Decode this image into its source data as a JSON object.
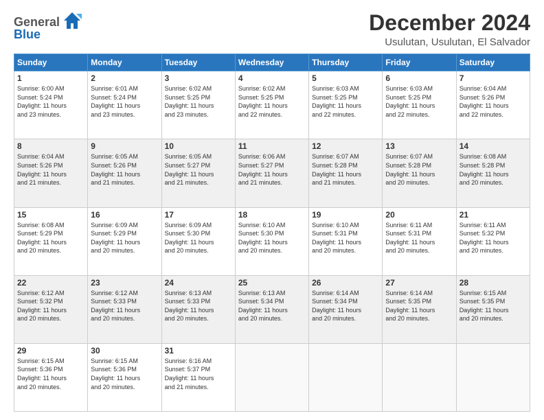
{
  "logo": {
    "general": "General",
    "blue": "Blue"
  },
  "title": "December 2024",
  "subtitle": "Usulutan, Usulutan, El Salvador",
  "calendar": {
    "headers": [
      "Sunday",
      "Monday",
      "Tuesday",
      "Wednesday",
      "Thursday",
      "Friday",
      "Saturday"
    ],
    "weeks": [
      [
        {
          "day": "",
          "info": ""
        },
        {
          "day": "2",
          "info": "Sunrise: 6:01 AM\nSunset: 5:24 PM\nDaylight: 11 hours\nand 23 minutes."
        },
        {
          "day": "3",
          "info": "Sunrise: 6:02 AM\nSunset: 5:25 PM\nDaylight: 11 hours\nand 23 minutes."
        },
        {
          "day": "4",
          "info": "Sunrise: 6:02 AM\nSunset: 5:25 PM\nDaylight: 11 hours\nand 22 minutes."
        },
        {
          "day": "5",
          "info": "Sunrise: 6:03 AM\nSunset: 5:25 PM\nDaylight: 11 hours\nand 22 minutes."
        },
        {
          "day": "6",
          "info": "Sunrise: 6:03 AM\nSunset: 5:25 PM\nDaylight: 11 hours\nand 22 minutes."
        },
        {
          "day": "7",
          "info": "Sunrise: 6:04 AM\nSunset: 5:26 PM\nDaylight: 11 hours\nand 22 minutes."
        }
      ],
      [
        {
          "day": "1",
          "info": "Sunrise: 6:00 AM\nSunset: 5:24 PM\nDaylight: 11 hours\nand 23 minutes."
        },
        {
          "day": "9",
          "info": "Sunrise: 6:05 AM\nSunset: 5:26 PM\nDaylight: 11 hours\nand 21 minutes."
        },
        {
          "day": "10",
          "info": "Sunrise: 6:05 AM\nSunset: 5:27 PM\nDaylight: 11 hours\nand 21 minutes."
        },
        {
          "day": "11",
          "info": "Sunrise: 6:06 AM\nSunset: 5:27 PM\nDaylight: 11 hours\nand 21 minutes."
        },
        {
          "day": "12",
          "info": "Sunrise: 6:07 AM\nSunset: 5:28 PM\nDaylight: 11 hours\nand 21 minutes."
        },
        {
          "day": "13",
          "info": "Sunrise: 6:07 AM\nSunset: 5:28 PM\nDaylight: 11 hours\nand 20 minutes."
        },
        {
          "day": "14",
          "info": "Sunrise: 6:08 AM\nSunset: 5:28 PM\nDaylight: 11 hours\nand 20 minutes."
        }
      ],
      [
        {
          "day": "8",
          "info": "Sunrise: 6:04 AM\nSunset: 5:26 PM\nDaylight: 11 hours\nand 21 minutes."
        },
        {
          "day": "16",
          "info": "Sunrise: 6:09 AM\nSunset: 5:29 PM\nDaylight: 11 hours\nand 20 minutes."
        },
        {
          "day": "17",
          "info": "Sunrise: 6:09 AM\nSunset: 5:30 PM\nDaylight: 11 hours\nand 20 minutes."
        },
        {
          "day": "18",
          "info": "Sunrise: 6:10 AM\nSunset: 5:30 PM\nDaylight: 11 hours\nand 20 minutes."
        },
        {
          "day": "19",
          "info": "Sunrise: 6:10 AM\nSunset: 5:31 PM\nDaylight: 11 hours\nand 20 minutes."
        },
        {
          "day": "20",
          "info": "Sunrise: 6:11 AM\nSunset: 5:31 PM\nDaylight: 11 hours\nand 20 minutes."
        },
        {
          "day": "21",
          "info": "Sunrise: 6:11 AM\nSunset: 5:32 PM\nDaylight: 11 hours\nand 20 minutes."
        }
      ],
      [
        {
          "day": "15",
          "info": "Sunrise: 6:08 AM\nSunset: 5:29 PM\nDaylight: 11 hours\nand 20 minutes."
        },
        {
          "day": "23",
          "info": "Sunrise: 6:12 AM\nSunset: 5:33 PM\nDaylight: 11 hours\nand 20 minutes."
        },
        {
          "day": "24",
          "info": "Sunrise: 6:13 AM\nSunset: 5:33 PM\nDaylight: 11 hours\nand 20 minutes."
        },
        {
          "day": "25",
          "info": "Sunrise: 6:13 AM\nSunset: 5:34 PM\nDaylight: 11 hours\nand 20 minutes."
        },
        {
          "day": "26",
          "info": "Sunrise: 6:14 AM\nSunset: 5:34 PM\nDaylight: 11 hours\nand 20 minutes."
        },
        {
          "day": "27",
          "info": "Sunrise: 6:14 AM\nSunset: 5:35 PM\nDaylight: 11 hours\nand 20 minutes."
        },
        {
          "day": "28",
          "info": "Sunrise: 6:15 AM\nSunset: 5:35 PM\nDaylight: 11 hours\nand 20 minutes."
        }
      ],
      [
        {
          "day": "22",
          "info": "Sunrise: 6:12 AM\nSunset: 5:32 PM\nDaylight: 11 hours\nand 20 minutes."
        },
        {
          "day": "30",
          "info": "Sunrise: 6:15 AM\nSunset: 5:36 PM\nDaylight: 11 hours\nand 20 minutes."
        },
        {
          "day": "31",
          "info": "Sunrise: 6:16 AM\nSunset: 5:37 PM\nDaylight: 11 hours\nand 21 minutes."
        },
        {
          "day": "",
          "info": ""
        },
        {
          "day": "",
          "info": ""
        },
        {
          "day": "",
          "info": ""
        },
        {
          "day": "",
          "info": ""
        }
      ],
      [
        {
          "day": "29",
          "info": "Sunrise: 6:15 AM\nSunset: 5:36 PM\nDaylight: 11 hours\nand 20 minutes."
        },
        {
          "day": "",
          "info": ""
        },
        {
          "day": "",
          "info": ""
        },
        {
          "day": "",
          "info": ""
        },
        {
          "day": "",
          "info": ""
        },
        {
          "day": "",
          "info": ""
        },
        {
          "day": "",
          "info": ""
        }
      ]
    ]
  }
}
